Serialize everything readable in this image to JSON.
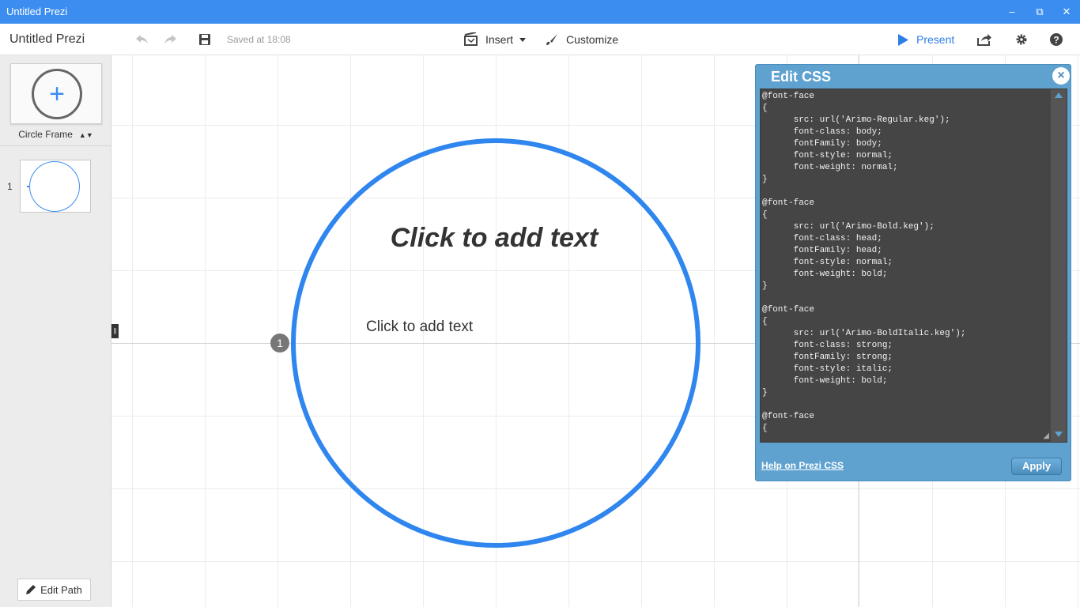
{
  "window": {
    "title": "Untitled Prezi",
    "minimize_glyph": "‒",
    "restore_glyph": "⧉",
    "close_glyph": "✕"
  },
  "toolbar": {
    "doc_title": "Untitled Prezi",
    "saved_status": "Saved at 18:08",
    "insert_label": "Insert",
    "customize_label": "Customize",
    "present_label": "Present",
    "icons": [
      "undo-icon",
      "redo-icon",
      "save-icon",
      "insert-icon",
      "brush-icon",
      "play-icon",
      "share-icon",
      "gear-icon",
      "help-icon"
    ]
  },
  "sidebar": {
    "frame_picker_glyph": "+",
    "frame_type": "Circle Frame",
    "frame_type_arrows": "▲▼",
    "path_items": [
      {
        "number": "1"
      }
    ],
    "edit_path_label": "Edit Path"
  },
  "canvas": {
    "frame_badge": "1",
    "title_placeholder": "Click to add text",
    "body_placeholder": "Click to add text",
    "handle_glyph": "||"
  },
  "css_panel": {
    "title": "Edit CSS",
    "close_glyph": "×",
    "code": "@font-face\n{\n      src: url('Arimo-Regular.keg');\n      font-class: body;\n      fontFamily: body;\n      font-style: normal;\n      font-weight: normal;\n}\n\n@font-face\n{\n      src: url('Arimo-Bold.keg');\n      font-class: head;\n      fontFamily: head;\n      font-style: normal;\n      font-weight: bold;\n}\n\n@font-face\n{\n      src: url('Arimo-BoldItalic.keg');\n      font-class: strong;\n      fontFamily: strong;\n      font-style: italic;\n      font-weight: bold;\n}\n\n@font-face\n{",
    "help_link": "Help on Prezi CSS",
    "apply_label": "Apply",
    "resize_glyph": "◢"
  },
  "colors": {
    "title_bar": "#3b8df0",
    "accent": "#2f86ee",
    "panel": "#5fa2d0",
    "editor_bg": "#454545"
  }
}
